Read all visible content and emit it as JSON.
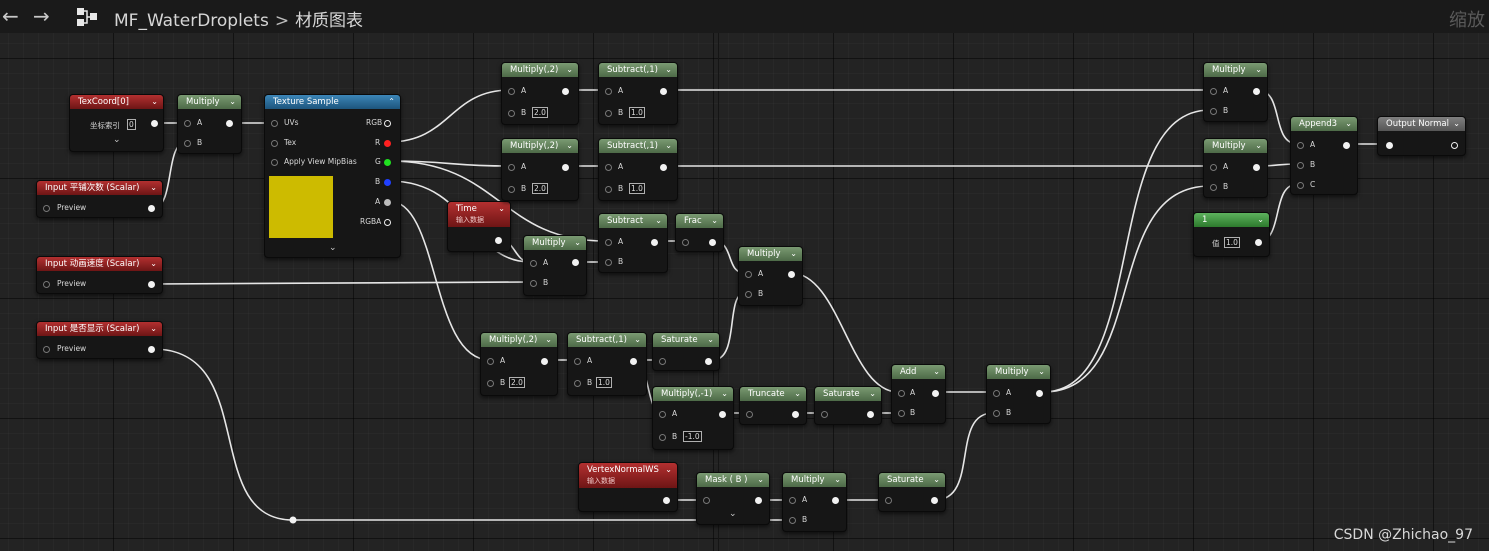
{
  "topbar": {
    "back_arrow": "←",
    "forward_arrow": "→",
    "asset_name": "MF_WaterDroplets",
    "separator": ">",
    "graph_title": "材质图表",
    "zoom_label": "缩放"
  },
  "watermark": "CSDN @Zhichao_97",
  "nodes": {
    "texcoord": {
      "title": "TexCoord[0]",
      "pin": "坐标索引",
      "value": "0",
      "expand": "⌄"
    },
    "input_tiling": {
      "title": "Input 平铺次数 (Scalar)",
      "pin": "Preview"
    },
    "input_speed": {
      "title": "Input 动画速度 (Scalar)",
      "pin": "Preview"
    },
    "input_show": {
      "title": "Input 是否显示 (Scalar)",
      "pin": "Preview"
    },
    "multiply_uv": {
      "title": "Multiply",
      "a": "A",
      "b": "B"
    },
    "texture_sample": {
      "title": "Texture Sample",
      "uvs": "UVs",
      "tex": "Tex",
      "mipbias": "Apply View MipBias",
      "rgb": "RGB",
      "r": "R",
      "g": "G",
      "b": "B",
      "a": "A",
      "rgba": "RGBA",
      "expand": "⌄"
    },
    "time": {
      "title": "Time",
      "sub": "输入数据"
    },
    "multiply_time": {
      "title": "Multiply",
      "a": "A",
      "b": "B"
    },
    "mul2_r": {
      "title": "Multiply(,2)",
      "a": "A",
      "b": "B",
      "bval": "2.0"
    },
    "sub1_r": {
      "title": "Subtract(,1)",
      "a": "A",
      "b": "B",
      "bval": "1.0"
    },
    "mul2_g": {
      "title": "Multiply(,2)",
      "a": "A",
      "b": "B",
      "bval": "2.0"
    },
    "sub1_g": {
      "title": "Subtract(,1)",
      "a": "A",
      "b": "B",
      "bval": "1.0"
    },
    "subtract_b": {
      "title": "Subtract",
      "a": "A",
      "b": "B"
    },
    "frac": {
      "title": "Frac"
    },
    "multiply_mid": {
      "title": "Multiply",
      "a": "A",
      "b": "B"
    },
    "mul2_a": {
      "title": "Multiply(,2)",
      "a": "A",
      "b": "B",
      "bval": "2.0"
    },
    "sub1_a": {
      "title": "Subtract(,1)",
      "a": "A",
      "b": "B",
      "bval": "1.0"
    },
    "saturate_1": {
      "title": "Saturate"
    },
    "mul_neg1": {
      "title": "Multiply(,-1)",
      "a": "A",
      "b": "B",
      "bval": "-1.0"
    },
    "truncate": {
      "title": "Truncate"
    },
    "saturate_2": {
      "title": "Saturate"
    },
    "add": {
      "title": "Add",
      "a": "A",
      "b": "B"
    },
    "multiply_out": {
      "title": "Multiply",
      "a": "A",
      "b": "B"
    },
    "vnormal": {
      "title": "VertexNormalWS",
      "sub": "输入数据"
    },
    "mask_b": {
      "title": "Mask ( B )",
      "expand": "⌄"
    },
    "multiply_mask": {
      "title": "Multiply",
      "a": "A",
      "b": "B"
    },
    "saturate_3": {
      "title": "Saturate"
    },
    "multiply_r_final": {
      "title": "Multiply",
      "a": "A",
      "b": "B"
    },
    "multiply_g_final": {
      "title": "Multiply",
      "a": "A",
      "b": "B"
    },
    "const_1": {
      "title": "1",
      "pin": "值",
      "value": "1.0"
    },
    "append3": {
      "title": "Append3",
      "a": "A",
      "b": "B",
      "c": "C"
    },
    "output_normal": {
      "title": "Output Normal"
    }
  },
  "colors": {
    "graph_bg": "#232323",
    "topbar_bg": "#1a1a1a",
    "math_header": "#5f7f58",
    "input_header": "#8f2020",
    "texture_header": "#2d6f9e",
    "output_header": "#6a6a6a",
    "constant_header": "#3f993f",
    "preview_swatch": "#cdbb00",
    "pin_r": "#ff2020",
    "pin_g": "#20e020",
    "pin_b": "#2040ff"
  }
}
